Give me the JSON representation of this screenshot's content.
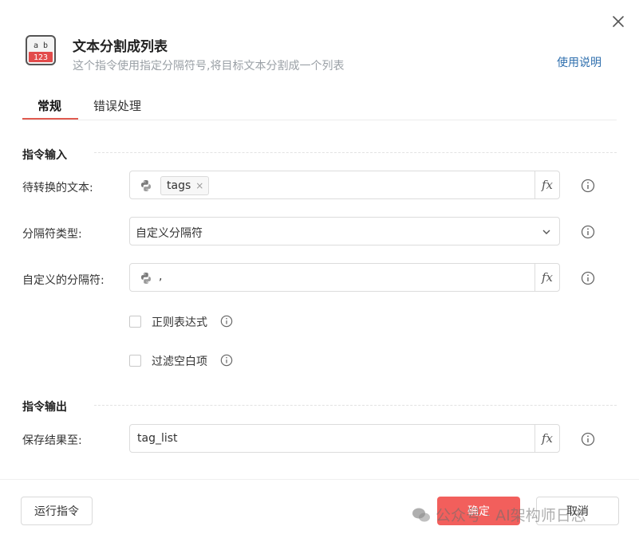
{
  "header": {
    "title": "文本分割成列表",
    "subtitle": "这个指令使用指定分隔符号,将目标文本分割成一个列表",
    "help_link": "使用说明",
    "icon_text_top": "a b",
    "icon_text_bottom": "123"
  },
  "tabs": [
    {
      "label": "常规",
      "active": true
    },
    {
      "label": "错误处理",
      "active": false
    }
  ],
  "input_section": {
    "title": "指令输入",
    "rows": {
      "text": {
        "label": "待转换的文本:",
        "tag": "tags",
        "tag_remove": "×",
        "fx": "fx"
      },
      "separator_type": {
        "label": "分隔符类型:",
        "value": "自定义分隔符"
      },
      "custom_separator": {
        "label": "自定义的分隔符:",
        "value": ",",
        "fx": "fx"
      }
    },
    "checkboxes": [
      {
        "label": "正则表达式",
        "checked": false
      },
      {
        "label": "过滤空白项",
        "checked": false
      }
    ]
  },
  "output_section": {
    "title": "指令输出",
    "save_to": {
      "label": "保存结果至:",
      "value": "tag_list",
      "fx": "fx"
    }
  },
  "footer": {
    "run_label": "运行指令",
    "ok_label": "确定",
    "cancel_label": "取消"
  },
  "watermark": "公众号 · AI架构师日志",
  "colors": {
    "accent": "#f25f5c",
    "link": "#2f6fae",
    "tab_underline": "#e05a4f"
  }
}
